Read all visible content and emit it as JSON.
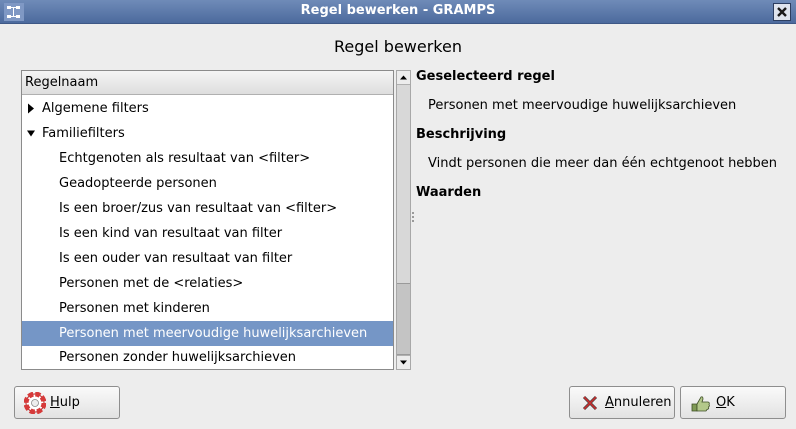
{
  "window": {
    "title": "Regel bewerken - GRAMPS"
  },
  "dialog": {
    "heading": "Regel bewerken"
  },
  "rule_list": {
    "column_header": "Regelnaam",
    "items": [
      {
        "label": "Algemene filters",
        "level": 0,
        "expander": "collapsed"
      },
      {
        "label": "Familiefilters",
        "level": 0,
        "expander": "expanded"
      },
      {
        "label": "Echtgenoten als resultaat van <filter>",
        "level": 1
      },
      {
        "label": "Geadopteerde personen",
        "level": 1
      },
      {
        "label": "Is een broer/zus van resultaat van <filter>",
        "level": 1
      },
      {
        "label": "Is een kind van resultaat van filter",
        "level": 1
      },
      {
        "label": "Is een ouder van resultaat van filter",
        "level": 1
      },
      {
        "label": "Personen met de <relaties>",
        "level": 1
      },
      {
        "label": "Personen met kinderen",
        "level": 1
      },
      {
        "label": "Personen met meervoudige huwelijksarchieven",
        "level": 1,
        "selected": true
      },
      {
        "label": "Personen zonder huwelijksarchieven",
        "level": 1
      }
    ]
  },
  "details": {
    "selected_rule_title": "Geselecteerd regel",
    "selected_rule_value": "Personen met meervoudige huwelijksarchieven",
    "description_title": "Beschrijving",
    "description_value": "Vindt personen die meer dan één echtgenoot hebben",
    "values_title": "Waarden"
  },
  "buttons": {
    "help_mnemonic": "H",
    "help_rest": "ulp",
    "cancel_mnemonic": "A",
    "cancel_rest": "nnuleren",
    "ok_mnemonic": "O",
    "ok_rest": "K"
  },
  "icons": {
    "help": "lifebuoy-icon",
    "cancel": "x-icon",
    "ok": "check-hand-icon",
    "expand_collapsed": "triangle-right-icon",
    "expand_expanded": "triangle-down-icon"
  },
  "colors": {
    "titlebar": "#5a77a8",
    "selection": "#7596c6"
  }
}
